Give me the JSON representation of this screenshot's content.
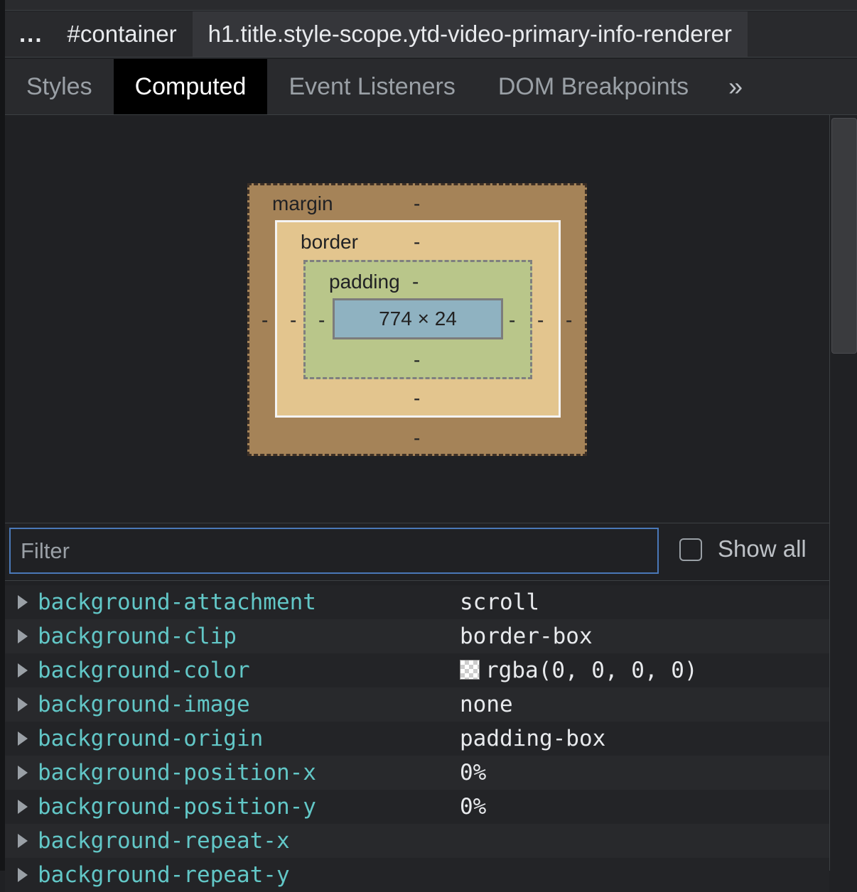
{
  "breadcrumb": {
    "items": [
      "...",
      "#container",
      "h1.title.style-scope.ytd-video-primary-info-renderer"
    ]
  },
  "tabs": {
    "items": [
      "Styles",
      "Computed",
      "Event Listeners",
      "DOM Breakpoints",
      "»"
    ],
    "active": "Computed"
  },
  "box_model": {
    "margin_label": "margin",
    "border_label": "border",
    "padding_label": "padding",
    "margin_top": "-",
    "margin_bottom": "-",
    "margin_left": "-",
    "margin_right": "-",
    "border_top": "-",
    "border_bottom": "-",
    "border_left": "-",
    "border_right": "-",
    "padding_top": "-",
    "padding_bottom": "-",
    "padding_left": "-",
    "padding_right": "-",
    "content": "774 × 24"
  },
  "filter": {
    "placeholder": "Filter",
    "value": "",
    "show_all_label": "Show all",
    "show_all_checked": false
  },
  "properties": [
    {
      "name": "background-attachment",
      "value": "scroll"
    },
    {
      "name": "background-clip",
      "value": "border-box"
    },
    {
      "name": "background-color",
      "value": "rgba(0, 0, 0, 0)"
    },
    {
      "name": "background-image",
      "value": "none"
    },
    {
      "name": "background-origin",
      "value": "padding-box"
    },
    {
      "name": "background-position-x",
      "value": "0%"
    },
    {
      "name": "background-position-y",
      "value": "0%"
    },
    {
      "name": "background-repeat-x",
      "value": ""
    },
    {
      "name": "background-repeat-y",
      "value": ""
    }
  ],
  "colors": {
    "panel_bg": "#202124",
    "prop_name": "#62c7c7",
    "active_tab_bg": "#000000",
    "filter_focus": "#4a78b8"
  },
  "icons": {
    "tab_overflow": "chevron-double-right-icon",
    "expand": "triangle-right-icon",
    "color_swatch": "transparent-swatch-icon"
  }
}
